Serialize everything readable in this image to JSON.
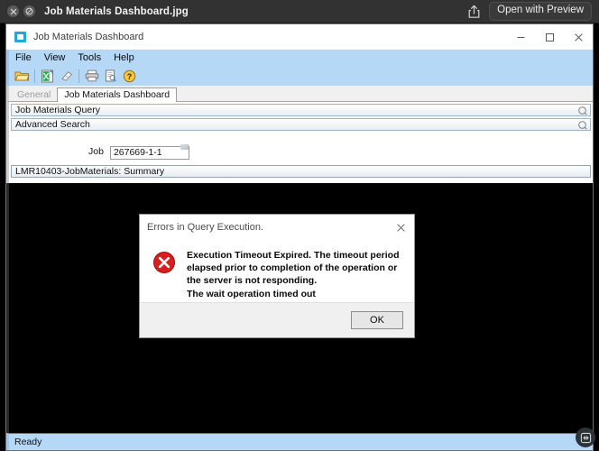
{
  "viewer": {
    "title": "Job Materials Dashboard.jpg",
    "close_icon": "close-circle-icon",
    "markup_icon": "markup-circle-icon",
    "share_icon": "share-icon",
    "open_with_label": "Open with Preview"
  },
  "app_window": {
    "title": "Job Materials Dashboard",
    "icon": "window-app-icon",
    "controls": {
      "minimize": "minimize-icon",
      "maximize": "maximize-icon",
      "close": "close-icon"
    }
  },
  "menubar": {
    "items": [
      {
        "label": "File"
      },
      {
        "label": "View"
      },
      {
        "label": "Tools"
      },
      {
        "label": "Help"
      }
    ]
  },
  "toolbar": {
    "buttons": [
      {
        "name": "open-folder-icon"
      },
      {
        "name": "export-excel-icon"
      },
      {
        "name": "eraser-icon"
      },
      {
        "name": "print-icon"
      },
      {
        "name": "print-preview-icon"
      },
      {
        "name": "help-icon"
      }
    ]
  },
  "tabs": [
    {
      "label": "General",
      "active": false
    },
    {
      "label": "Job Materials Dashboard",
      "active": true
    }
  ],
  "panel": {
    "groups": [
      {
        "label": "Job Materials Query",
        "icon": "collapse-refresh-icon"
      },
      {
        "label": "Advanced Search",
        "icon": "collapse-refresh-icon"
      }
    ],
    "job_field": {
      "label": "Job",
      "value": "267669-1-1",
      "placeholder": ""
    },
    "summary_bar": {
      "label": "LMR10403-JobMaterials: Summary"
    }
  },
  "statusbar": {
    "text": "Ready",
    "overlay_icon": "resize-fullscreen-icon"
  },
  "error_dialog": {
    "title": "Errors in Query Execution.",
    "close_icon": "close-icon",
    "icon": "error-circle-icon",
    "message_line1": "Execution Timeout Expired.  The timeout period elapsed prior to completion of the operation or the server is not responding.",
    "message_line2": "The wait operation timed out",
    "ok_label": "OK"
  },
  "colors": {
    "viewer_chrome": "#323232",
    "app_accent": "#b6d8f7",
    "error_red": "#d81f1f",
    "app_icon_blue": "#27a4d8"
  }
}
